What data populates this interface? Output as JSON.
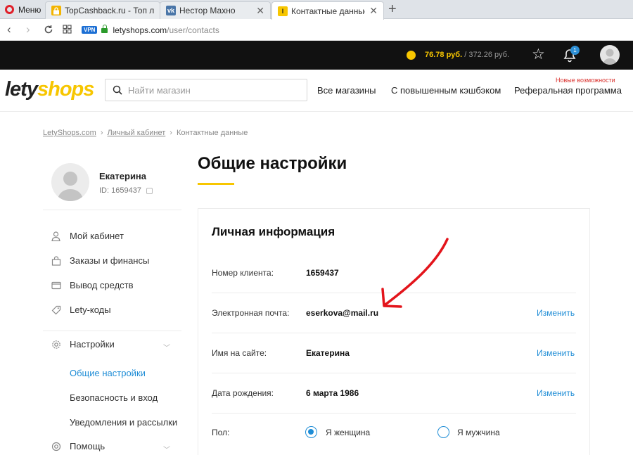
{
  "browser": {
    "menu_label": "Меню",
    "tabs": [
      {
        "title": "TopCashback.ru - Топ луч",
        "favicon": "lock-favicon"
      },
      {
        "title": "Нестор Махно",
        "favicon": "vk-favicon"
      },
      {
        "title": "Контактные данные",
        "favicon": "letyshops-favicon",
        "active": true
      }
    ],
    "vpn_label": "VPN",
    "url_host": "letyshops.com",
    "url_path": "/user/contacts"
  },
  "topbar": {
    "balance_current": "76.78 руб.",
    "balance_separator": "/",
    "balance_total": "372.26 руб.",
    "notifications_count": "1"
  },
  "header": {
    "logo_part1": "lety",
    "logo_part2": "shops",
    "search_placeholder": "Найти магазин",
    "nav": [
      "Все магазины",
      "С повышенным кэшбэком",
      "Реферальная программа"
    ],
    "new_features_label": "Новые возможности"
  },
  "breadcrumb": {
    "items": [
      "LetyShops.com",
      "Личный кабинет",
      "Контактные данные"
    ],
    "separator": "›"
  },
  "profile": {
    "name": "Екатерина",
    "id_text": "ID: 1659437"
  },
  "sidebar": {
    "items": [
      {
        "label": "Мой кабинет",
        "icon": "user-icon"
      },
      {
        "label": "Заказы и финансы",
        "icon": "bag-icon"
      },
      {
        "label": "Вывод средств",
        "icon": "wallet-icon"
      },
      {
        "label": "Lety-коды",
        "icon": "tag-icon"
      }
    ],
    "settings_label": "Настройки",
    "settings_subitems": [
      "Общие настройки",
      "Безопасность и вход",
      "Уведомления и рассылки"
    ],
    "help_label": "Помощь"
  },
  "main": {
    "title": "Общие настройки",
    "card_title": "Личная информация",
    "rows": [
      {
        "label": "Номер клиента:",
        "value": "1659437",
        "action": ""
      },
      {
        "label": "Электронная почта:",
        "value": "eserkova@mail.ru",
        "action": "Изменить"
      },
      {
        "label": "Имя на сайте:",
        "value": "Екатерина",
        "action": "Изменить"
      },
      {
        "label": "Дата рождения:",
        "value": "6 марта 1986",
        "action": "Изменить"
      }
    ],
    "gender_label": "Пол:",
    "gender_options": [
      {
        "label": "Я женщина",
        "checked": true
      },
      {
        "label": "Я мужчина",
        "checked": false
      }
    ]
  },
  "colors": {
    "accent_yellow": "#f7c600",
    "link_blue": "#1f8dd6",
    "annotation_red": "#e3141b"
  }
}
